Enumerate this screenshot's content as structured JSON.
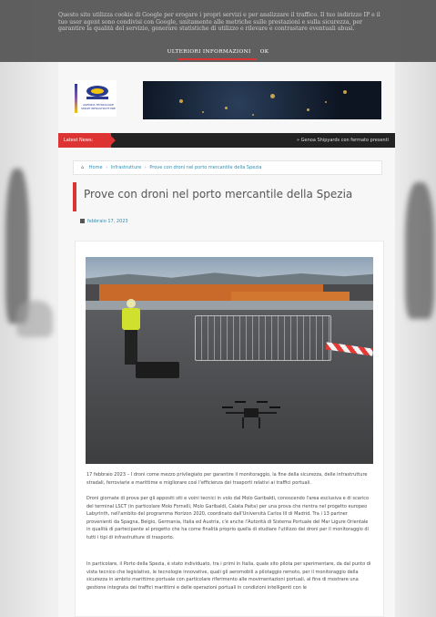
{
  "cookie_banner": {
    "text": "Questo sito utilizza cookie di Google per erogare i propri servizi e per analizzare il traffico. Il tuo indirizzo IP e il tuo user agent sono condivisi con Google, unitamente alle metriche sulle prestazioni e sulla sicurezza, per garantire la qualità del servizio, generare statistiche di utilizzo e rilevare e contrastare eventuali abusi.",
    "more_info_label": "ULTERIORI INFORMAZIONI",
    "ok_label": "OK"
  },
  "header": {
    "logo_text": "AGENZIA TECNOLOGIE SMART INFRASTRUTTURE"
  },
  "ticker": {
    "tag": "Latest News:",
    "headline": "» Genoa Shipyards con fermato presenti"
  },
  "breadcrumb": {
    "home": "Home",
    "section": "Infrastrutture",
    "current": "Prove con droni nel porto mercantile della Spezia"
  },
  "post": {
    "title": "Prove con droni nel porto mercantile della Spezia",
    "date": "febbraio 17, 2023",
    "paragraphs": [
      "17 febbraio 2023 – I droni come mezzo privilegiato per garantire il monitoraggio, la fine della sicurezza, delle infrastrutture stradali, ferroviarie e marittime e migliorare così l'efficienza dei trasporti relativi ai traffici portuali.",
      "Droni giornate di prova per gli appositi siti e voini tecnici in volo dal Molo Garibaldi, conoscendo l'area esclusiva e di scarico del terminal LSCT (in particolare Molo Fornelli, Molo Garibaldi, Calata Paita) per una prova che rientra nel progetto europeo Labyrinth, nell'ambito del programma Horizon 2020, coordinato dall'Università Carlos III di Madrid. Tra i 13 partner provenienti da Spagna, Belgio, Germania, Italia ed Austria, c'è anche l'Autorità di Sistema Portuale del Mar Ligure Orientale in qualità di partecipante al progetto che ha come finalità proprio quella di studiare l'utilizzo dei droni per il monitoraggio di tutti i tipi di infrastrutture di trasporto.",
      "In particolare, il Porto della Spezia, è stato individuato, tra i primi in Italia, quale sito pilota per sperimentare, da dal punto di vista tecnico che legislativo, le tecnologie innovative, quali gli aeromobili a pilotaggio remoto, per il monitoraggio della sicurezza in ambito marittimo portuale con particolare riferimento alle movimentazioni portuali, al fine di mostrare una gestione integrata dei traffici marittimi e delle operazioni portuali in condizioni intelligenti con le"
    ]
  }
}
